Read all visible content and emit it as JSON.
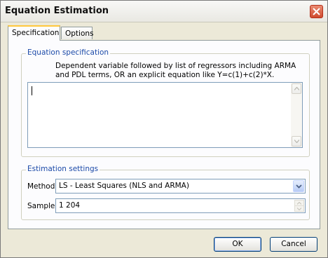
{
  "window": {
    "title": "Equation Estimation"
  },
  "tabs": [
    {
      "label": "Specification",
      "active": true
    },
    {
      "label": "Options",
      "active": false
    }
  ],
  "equation_specification": {
    "group_label": "Equation specification",
    "description_line1": "Dependent variable followed by list of regressors including ARMA",
    "description_line2": "and PDL terms, OR an explicit equation like Y=c(1)+c(2)*X.",
    "value": ""
  },
  "estimation_settings": {
    "group_label": "Estimation settings",
    "method_label": "Method:",
    "method_value": "LS  -  Least Squares (NLS and ARMA)",
    "sample_label": "Sample:",
    "sample_value": "1 204"
  },
  "buttons": {
    "ok": "OK",
    "cancel": "Cancel"
  },
  "colors": {
    "group_label": "#1c4aa8",
    "tab_highlight": "#ffc83c",
    "close_button": "#cf4a2e"
  }
}
